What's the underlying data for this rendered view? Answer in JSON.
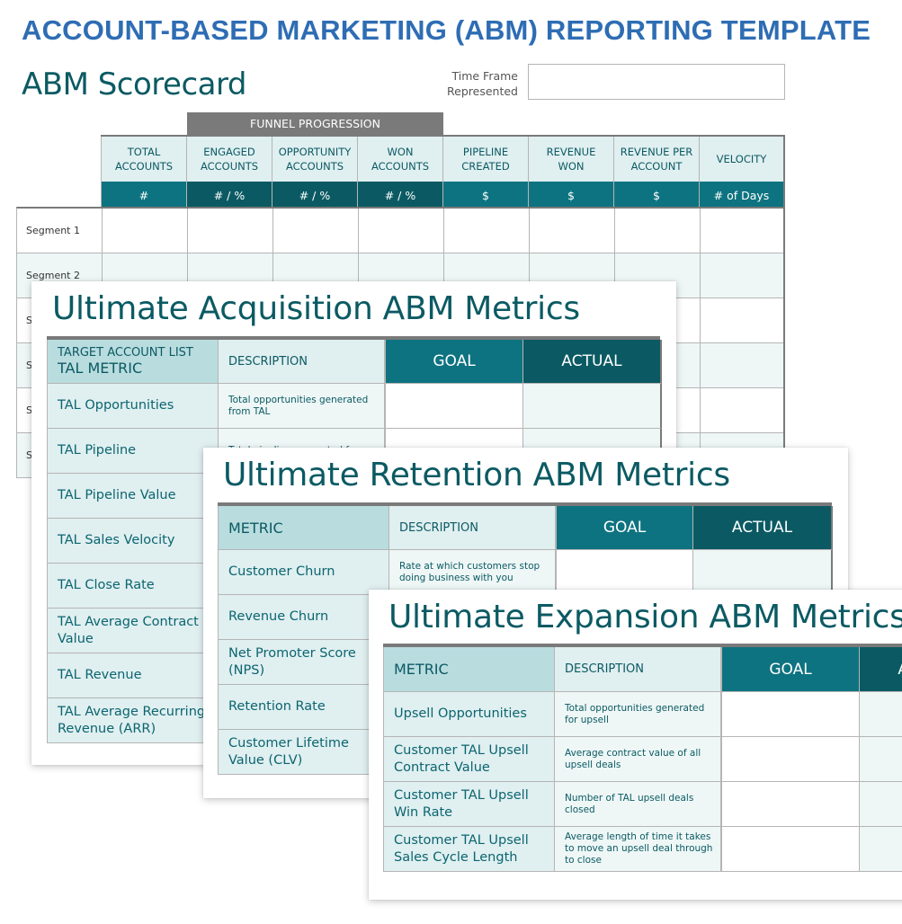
{
  "header": {
    "title": "ACCOUNT-BASED MARKETING (ABM) REPORTING TEMPLATE",
    "subtitle": "ABM Scorecard",
    "time_frame_label_1": "Time Frame",
    "time_frame_label_2": "Represented",
    "time_frame_value": ""
  },
  "colors": {
    "title_blue": "#2e6db4",
    "teal_dark": "#0b5a63",
    "teal": "#0e7380",
    "teal_light": "#b9dcdf",
    "teal_pale": "#e0eff0",
    "stripe": "#eef7f6",
    "funnel_gray": "#7a7a7a"
  },
  "scorecard": {
    "funnel_label": "FUNNEL PROGRESSION",
    "columns": [
      {
        "l1": "TOTAL",
        "l2": "ACCOUNTS",
        "unit": "#"
      },
      {
        "l1": "ENGAGED",
        "l2": "ACCOUNTS",
        "unit": "# / %"
      },
      {
        "l1": "OPPORTUNITY",
        "l2": "ACCOUNTS",
        "unit": "# / %"
      },
      {
        "l1": "WON",
        "l2": "ACCOUNTS",
        "unit": "# / %"
      },
      {
        "l1": "PIPELINE",
        "l2": "CREATED",
        "unit": "$"
      },
      {
        "l1": "REVENUE",
        "l2": "WON",
        "unit": "$"
      },
      {
        "l1": "REVENUE PER",
        "l2": "ACCOUNT",
        "unit": "$"
      },
      {
        "l1": "VELOCITY",
        "l2": "",
        "unit": "# of Days"
      }
    ],
    "segments": [
      "Segment 1",
      "Segment 2",
      "S",
      "S",
      "S",
      "S"
    ]
  },
  "acquisition": {
    "title": "Ultimate Acquisition ABM Metrics",
    "header_metric_small": "TARGET ACCOUNT LIST",
    "header_metric": "TAL METRIC",
    "header_description": "DESCRIPTION",
    "header_goal": "GOAL",
    "header_actual": "ACTUAL",
    "rows": [
      {
        "metric": "TAL Opportunities",
        "description": "Total opportunities generated from TAL"
      },
      {
        "metric": "TAL Pipeline",
        "description": "Total pipeline generated from"
      },
      {
        "metric": "TAL Pipeline Value",
        "description": ""
      },
      {
        "metric": "TAL Sales Velocity",
        "description": ""
      },
      {
        "metric": "TAL Close Rate",
        "description": ""
      },
      {
        "metric": "TAL Average Contract Value",
        "description": ""
      },
      {
        "metric": "TAL Revenue",
        "description": ""
      },
      {
        "metric": "TAL Average Recurring Revenue (ARR)",
        "description": ""
      }
    ]
  },
  "retention": {
    "title": "Ultimate Retention ABM Metrics",
    "header_metric": "METRIC",
    "header_description": "DESCRIPTION",
    "header_goal": "GOAL",
    "header_actual": "ACTUAL",
    "rows": [
      {
        "metric": "Customer Churn",
        "description": "Rate at which customers stop doing business with you"
      },
      {
        "metric": "Revenue Churn",
        "description": ""
      },
      {
        "metric": "Net Promoter Score (NPS)",
        "description": ""
      },
      {
        "metric": "Retention Rate",
        "description": ""
      },
      {
        "metric": "Customer Lifetime Value (CLV)",
        "description": ""
      }
    ]
  },
  "expansion": {
    "title": "Ultimate Expansion ABM Metrics",
    "header_metric": "METRIC",
    "header_description": "DESCRIPTION",
    "header_goal": "GOAL",
    "header_actual": "ACTUAL",
    "rows": [
      {
        "metric": "Upsell Opportunities",
        "description": "Total opportunities generated for upsell"
      },
      {
        "metric": "Customer TAL Upsell Contract Value",
        "description": "Average contract value of all upsell deals"
      },
      {
        "metric": "Customer TAL Upsell Win Rate",
        "description": "Number of TAL upsell deals closed"
      },
      {
        "metric": "Customer TAL Upsell Sales Cycle Length",
        "description": "Average length of time it takes to move an upsell deal through to close"
      }
    ]
  }
}
